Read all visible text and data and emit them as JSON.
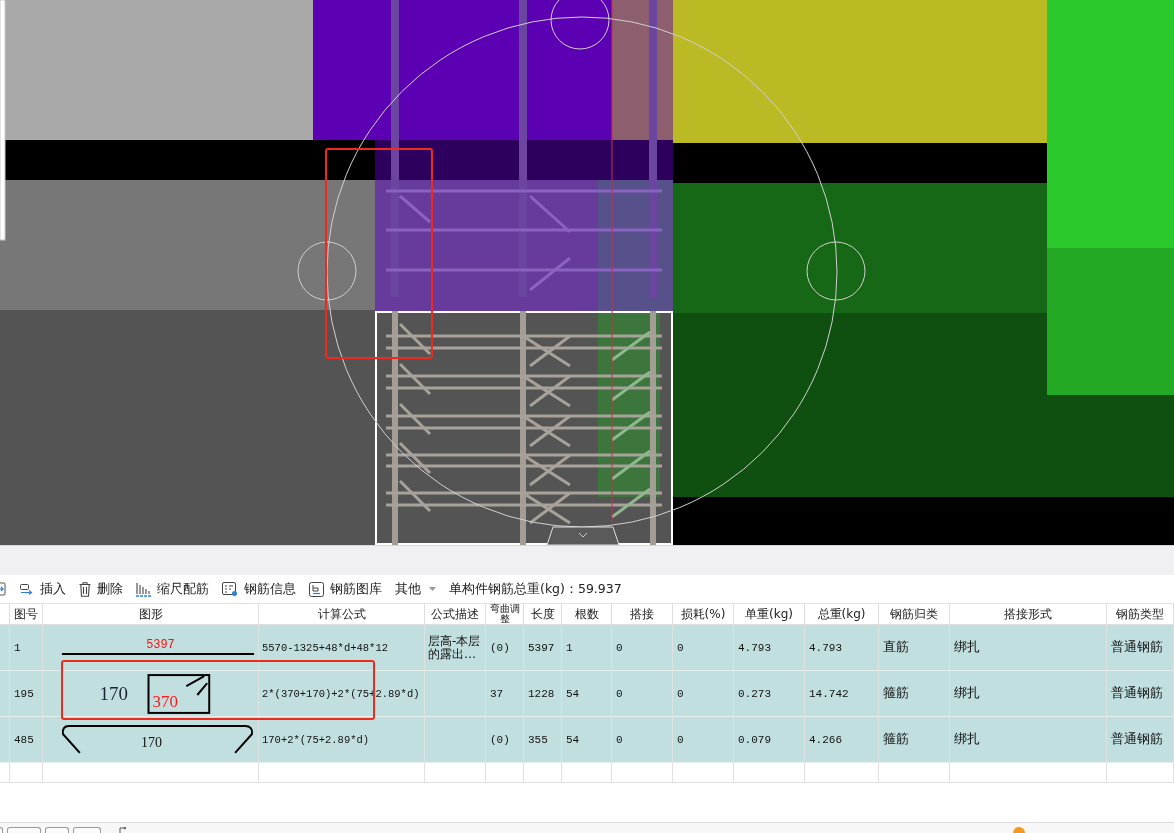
{
  "toolbar": {
    "items": [
      {
        "kind": "insert",
        "label": "插入"
      },
      {
        "kind": "delete",
        "label": "删除"
      },
      {
        "kind": "scale",
        "label": "缩尺配筋"
      },
      {
        "kind": "info",
        "label": "钢筋信息"
      },
      {
        "kind": "library",
        "label": "钢筋图库"
      },
      {
        "kind": "dropdown",
        "label": "其他"
      }
    ],
    "total": "单构件钢筋总重(kg)：59.937"
  },
  "table": {
    "columns": [
      "图号",
      "图形",
      "计算公式",
      "公式描述",
      "弯曲调整",
      "长度",
      "根数",
      "搭接",
      "损耗(%)",
      "单重(kg)",
      "总重(kg)",
      "钢筋归类",
      "搭接形式",
      "钢筋类型"
    ],
    "rows": [
      {
        "number": "1",
        "shape": {
          "kind": "straight",
          "dims": [
            "5397"
          ]
        },
        "formula": "5570-1325+48*d+48*12",
        "description": "层高-本层的露出…",
        "bend": "(0)",
        "length": "5397",
        "count": "1",
        "lap": "0",
        "loss": "0",
        "unit_weight": "4.793",
        "total_weight": "4.793",
        "category": "直筋",
        "lap_type": "绑扎",
        "bar_type": "普通钢筋"
      },
      {
        "number": "195",
        "shape": {
          "kind": "stirrup",
          "dims": [
            "170",
            "370"
          ]
        },
        "formula": "2*(370+170)+2*(75+2.89*d)",
        "bend": "37",
        "length": "1228",
        "count": "54",
        "lap": "0",
        "loss": "0",
        "unit_weight": "0.273",
        "total_weight": "14.742",
        "category": "箍筋",
        "lap_type": "绑扎",
        "bar_type": "普通钢筋"
      },
      {
        "number": "485",
        "shape": {
          "kind": "hooked",
          "dims": [
            "170"
          ]
        },
        "formula": "170+2*(75+2.89*d)",
        "bend": "(0)",
        "length": "355",
        "count": "54",
        "lap": "0",
        "loss": "0",
        "unit_weight": "0.079",
        "total_weight": "4.266",
        "category": "箍筋",
        "lap_type": "绑扎",
        "bar_type": "普通钢筋"
      }
    ]
  }
}
